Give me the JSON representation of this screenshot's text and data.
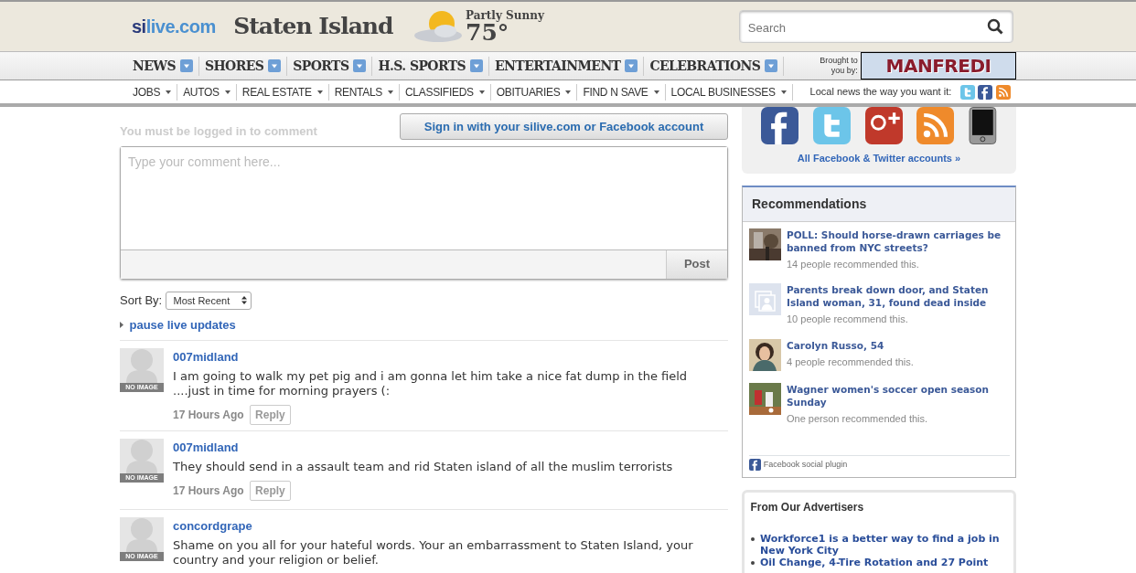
{
  "header": {
    "logo": {
      "prefix": "si",
      "suffix": "live.com"
    },
    "site_title": "Staten Island",
    "weather": {
      "condition": "Partly Sunny",
      "temperature": "75°"
    },
    "search": {
      "placeholder": "Search"
    }
  },
  "main_nav": [
    {
      "label": "NEWS"
    },
    {
      "label": "SHORES"
    },
    {
      "label": "SPORTS"
    },
    {
      "label": "H.S. SPORTS"
    },
    {
      "label": "ENTERTAINMENT"
    },
    {
      "label": "CELEBRATIONS"
    }
  ],
  "sponsor": {
    "label": "Brought to you by:",
    "name": "MANFREDI"
  },
  "sub_nav": [
    {
      "label": "JOBS"
    },
    {
      "label": "AUTOS"
    },
    {
      "label": "REAL ESTATE"
    },
    {
      "label": "RENTALS"
    },
    {
      "label": "CLASSIFIEDS"
    },
    {
      "label": "OBITUARIES"
    },
    {
      "label": "FIND N SAVE"
    },
    {
      "label": "LOCAL BUSINESSES"
    }
  ],
  "tagline": {
    "text": "Local news the way you want it:",
    "icons": [
      {
        "kind": "twitter"
      },
      {
        "kind": "facebook"
      },
      {
        "kind": "rss"
      }
    ]
  },
  "comment_form": {
    "login_notice": "You must be logged in to comment",
    "signin_button": "Sign in with your silive.com or Facebook account",
    "placeholder": "Type your comment here...",
    "post_button": "Post"
  },
  "sort": {
    "label": "Sort By:",
    "value": "Most Recent"
  },
  "live_updates": "pause live updates",
  "comments": [
    {
      "author": "007midland",
      "avatar_label": "NO IMAGE",
      "text": "I am going to walk my pet pig and i am gonna let him take a nice fat dump in the field ....just in time for morning prayers (:",
      "time": "17 Hours Ago",
      "reply": "Reply"
    },
    {
      "author": "007midland",
      "avatar_label": "NO IMAGE",
      "text": "They should send in a assault team and rid Staten island of all the muslim terrorists",
      "time": "17 Hours Ago",
      "reply": "Reply"
    },
    {
      "author": "concordgrape",
      "avatar_label": "NO IMAGE",
      "text": "Shame on you all for your hateful words. Your an embarrassment to Staten Island, your country and your religion or belief."
    }
  ],
  "social": {
    "icons": [
      {
        "kind": "facebook"
      },
      {
        "kind": "twitter"
      },
      {
        "kind": "googleplus"
      },
      {
        "kind": "rss"
      },
      {
        "kind": "phone"
      }
    ],
    "link": "All Facebook & Twitter accounts »"
  },
  "recommendations": {
    "title": "Recommendations",
    "items": [
      {
        "kind": "picture",
        "title": "POLL: Should horse-drawn carriages be banned from NYC streets?",
        "count": "14 people recommended this."
      },
      {
        "kind": "placeholder",
        "title": "Parents break down door, and Staten Island woman, 31, found dead inside",
        "count": "10 people recommend this."
      },
      {
        "kind": "picture",
        "title": "Carolyn Russo, 54",
        "count": "4 people recommended this."
      },
      {
        "kind": "picture",
        "title": "Wagner women's soccer open season Sunday",
        "count": "One person recommended this."
      }
    ],
    "footer": "Facebook social plugin"
  },
  "advertisers": {
    "title": "From Our Advertisers",
    "items": [
      "Workforce1 is a better way to find a job in New York City",
      "Oil Change, 4-Tire Rotation and 27 Point"
    ]
  }
}
